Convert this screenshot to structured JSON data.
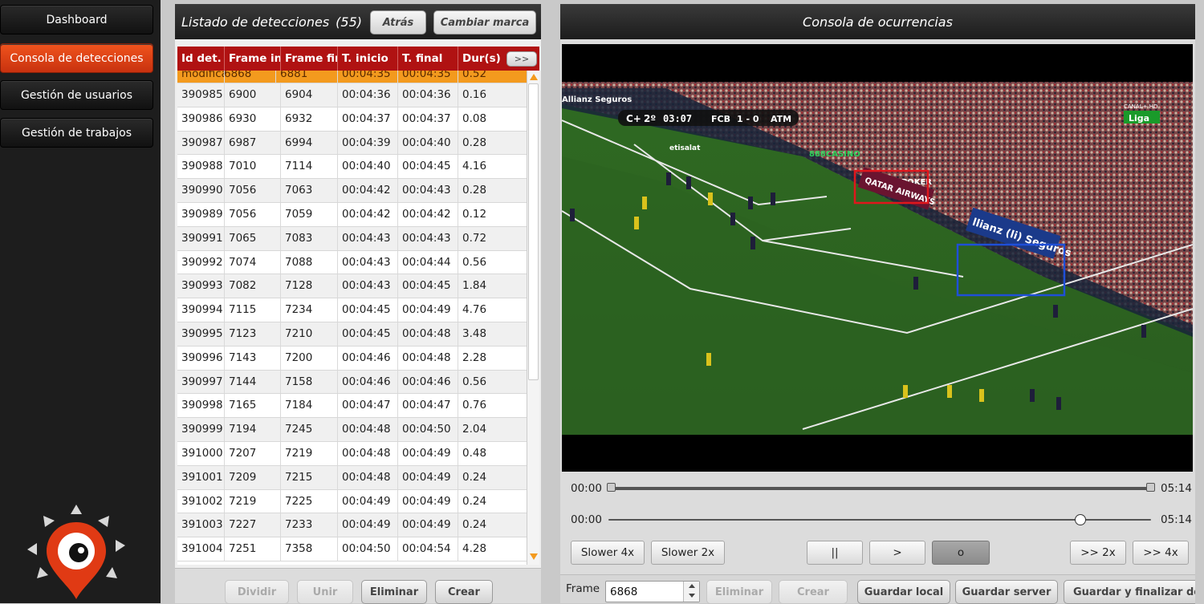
{
  "sidebar": {
    "items": [
      {
        "label": "Dashboard",
        "active": false
      },
      {
        "label": "Consola de detecciones",
        "active": true
      },
      {
        "label": "Gestión de usuarios",
        "active": false
      },
      {
        "label": "Gestión de trabajos",
        "active": false
      }
    ],
    "logo_icon": "eye-pin-logo-icon"
  },
  "detections": {
    "title": "Listado de detecciones",
    "count": "(55)",
    "back_label": "Atrás",
    "change_label": "Cambiar marca",
    "expand_label": ">>",
    "columns": [
      "Id det.",
      "Frame inc",
      "Frame fin",
      "T. inicio",
      "T. final",
      "Dur(s)"
    ],
    "selected_row": {
      "id": "modificado",
      "frame_ini": "6868",
      "frame_fin": "6881",
      "t_ini": "00:04:35",
      "t_fin": "00:04:35",
      "dur": "0.52"
    },
    "rows": [
      [
        "390985",
        "6900",
        "6904",
        "00:04:36",
        "00:04:36",
        "0.16"
      ],
      [
        "390986",
        "6930",
        "6932",
        "00:04:37",
        "00:04:37",
        "0.08"
      ],
      [
        "390987",
        "6987",
        "6994",
        "00:04:39",
        "00:04:40",
        "0.28"
      ],
      [
        "390988",
        "7010",
        "7114",
        "00:04:40",
        "00:04:45",
        "4.16"
      ],
      [
        "390990",
        "7056",
        "7063",
        "00:04:42",
        "00:04:43",
        "0.28"
      ],
      [
        "390989",
        "7056",
        "7059",
        "00:04:42",
        "00:04:42",
        "0.12"
      ],
      [
        "390991",
        "7065",
        "7083",
        "00:04:43",
        "00:04:43",
        "0.72"
      ],
      [
        "390992",
        "7074",
        "7088",
        "00:04:43",
        "00:04:44",
        "0.56"
      ],
      [
        "390993",
        "7082",
        "7128",
        "00:04:43",
        "00:04:45",
        "1.84"
      ],
      [
        "390994",
        "7115",
        "7234",
        "00:04:45",
        "00:04:49",
        "4.76"
      ],
      [
        "390995",
        "7123",
        "7210",
        "00:04:45",
        "00:04:48",
        "3.48"
      ],
      [
        "390996",
        "7143",
        "7200",
        "00:04:46",
        "00:04:48",
        "2.28"
      ],
      [
        "390997",
        "7144",
        "7158",
        "00:04:46",
        "00:04:46",
        "0.56"
      ],
      [
        "390998",
        "7165",
        "7184",
        "00:04:47",
        "00:04:47",
        "0.76"
      ],
      [
        "390999",
        "7194",
        "7245",
        "00:04:48",
        "00:04:50",
        "2.04"
      ],
      [
        "391000",
        "7207",
        "7219",
        "00:04:48",
        "00:04:49",
        "0.48"
      ],
      [
        "391001",
        "7209",
        "7215",
        "00:04:48",
        "00:04:49",
        "0.24"
      ],
      [
        "391002",
        "7219",
        "7225",
        "00:04:49",
        "00:04:49",
        "0.24"
      ],
      [
        "391003",
        "7227",
        "7233",
        "00:04:49",
        "00:04:49",
        "0.24"
      ],
      [
        "391004",
        "7251",
        "7358",
        "00:04:50",
        "00:04:54",
        "4.28"
      ]
    ],
    "actions": {
      "split": "Dividir",
      "merge": "Unir",
      "delete": "Eliminar",
      "create": "Crear"
    }
  },
  "console": {
    "title": "Consola de ocurrencias",
    "scoreboard": {
      "channel": "C+",
      "period": "2º",
      "clock": "03:07",
      "home": "FCB",
      "score": "1 - 0",
      "away": "ATM"
    },
    "broadcaster": {
      "line1": "CANAL+ HD",
      "line2": "Liga"
    },
    "ad_boards": [
      "QATAR AIRWAYS",
      "llianz (li) Seguros",
      "888CASINO",
      "888POKER",
      "etisalat",
      "Allianz Seguros"
    ],
    "range_slider": {
      "start": "00:00",
      "end": "05:14",
      "from": 0.0,
      "to": 1.0
    },
    "position_slider": {
      "start": "00:00",
      "end": "05:14",
      "value": 0.87
    },
    "controls": {
      "slower4": "Slower 4x",
      "slower2": "Slower 2x",
      "pause": "||",
      "play": ">",
      "stop": "o",
      "faster2": ">> 2x",
      "faster4": ">> 4x"
    },
    "frame_label": "Frame",
    "frame_value": "6868",
    "actions": {
      "delete": "Eliminar",
      "create": "Crear",
      "save_local": "Guardar local",
      "save_server": "Guardar server",
      "save_finish": "Guardar y finalizar depu"
    },
    "colors": {
      "box_red": "#e0161c",
      "box_blue": "#1f4fd8",
      "pitch": "#2e6e26"
    }
  }
}
